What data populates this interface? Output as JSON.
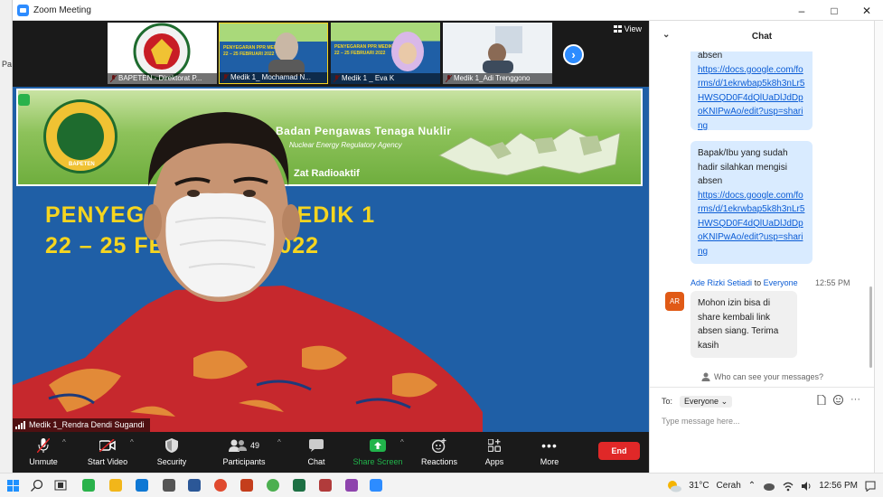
{
  "window": {
    "title": "Zoom Meeting",
    "minimize": "–",
    "maximize": "□",
    "close": "✕"
  },
  "background_app": {
    "fragment": "Pa"
  },
  "gallery": {
    "view_label": "View",
    "thumbnails": [
      {
        "name": "BAPETEN - Direktorat P..."
      },
      {
        "name": "Medik 1_ Mochamad N..."
      },
      {
        "name": "Medik 1 _ Eva K"
      },
      {
        "name": "Medik 1_Adi Trenggono"
      }
    ],
    "thumb_slide_texts": [
      "PENYEGARAN PPR MEDIK 1",
      "22 – 25 FEBRUARI 2022",
      "PENYEGARAN PPR MEDIK",
      "22 – 25 FEBRUARI 2022"
    ]
  },
  "main_video": {
    "banner_title": "Badan Pengawas Tenaga Nuklir",
    "banner_subtitle": "Nuclear Energy Regulatory Agency",
    "banner_line3": "Zat Radioaktif",
    "logo_text": "BAPETEN",
    "slide_title": "PENYEGARAN PPR MEDIK 1",
    "slide_date": "22 – 25 FEBRUARI 2022",
    "participant_label": "Medik 1_Rendra Dendi Sugandi"
  },
  "toolbar": {
    "unmute": "Unmute",
    "start_video": "Start Video",
    "security": "Security",
    "participants": "Participants",
    "participants_count": "49",
    "chat": "Chat",
    "share_screen": "Share Screen",
    "reactions": "Reactions",
    "apps": "Apps",
    "more": "More",
    "end": "End"
  },
  "chat": {
    "title": "Chat",
    "messages": [
      {
        "text_before": "absen",
        "link": "https://docs.google.com/forms/d/1ekrwbap5k8h3nLr5HWSQD0F4dQlUaDlJdDpoKNIPwAo/edit?usp=sharing"
      },
      {
        "text_before": "Bapak/Ibu yang sudah hadir silahkan mengisi absen",
        "link": "https://docs.google.com/forms/d/1ekrwbap5k8h3nLr5HWSQD0F4dQlUaDlJdDpoKNIPwAo/edit?usp=sharing"
      }
    ],
    "last_message": {
      "sender": "Ade Rizki Setiadi",
      "to_word": "to",
      "recipient": "Everyone",
      "time": "12:55 PM",
      "initials": "AR",
      "text": "Mohon izin bisa di share kembali link absen siang. Terima kasih"
    },
    "privacy_text": "Who can see your messages?",
    "to_label": "To:",
    "to_value": "Everyone",
    "input_placeholder": "Type message here..."
  },
  "taskbar": {
    "weather_temp": "31°C",
    "weather_text": "Cerah",
    "time": "12:56 PM"
  },
  "colors": {
    "zoom_blue": "#2d8cff",
    "end_red": "#e02828",
    "slide_yellow": "#f6d51f",
    "chat_bubble": "#d9ebff",
    "avatar_orange": "#e05a16",
    "share_green": "#21b44b"
  }
}
